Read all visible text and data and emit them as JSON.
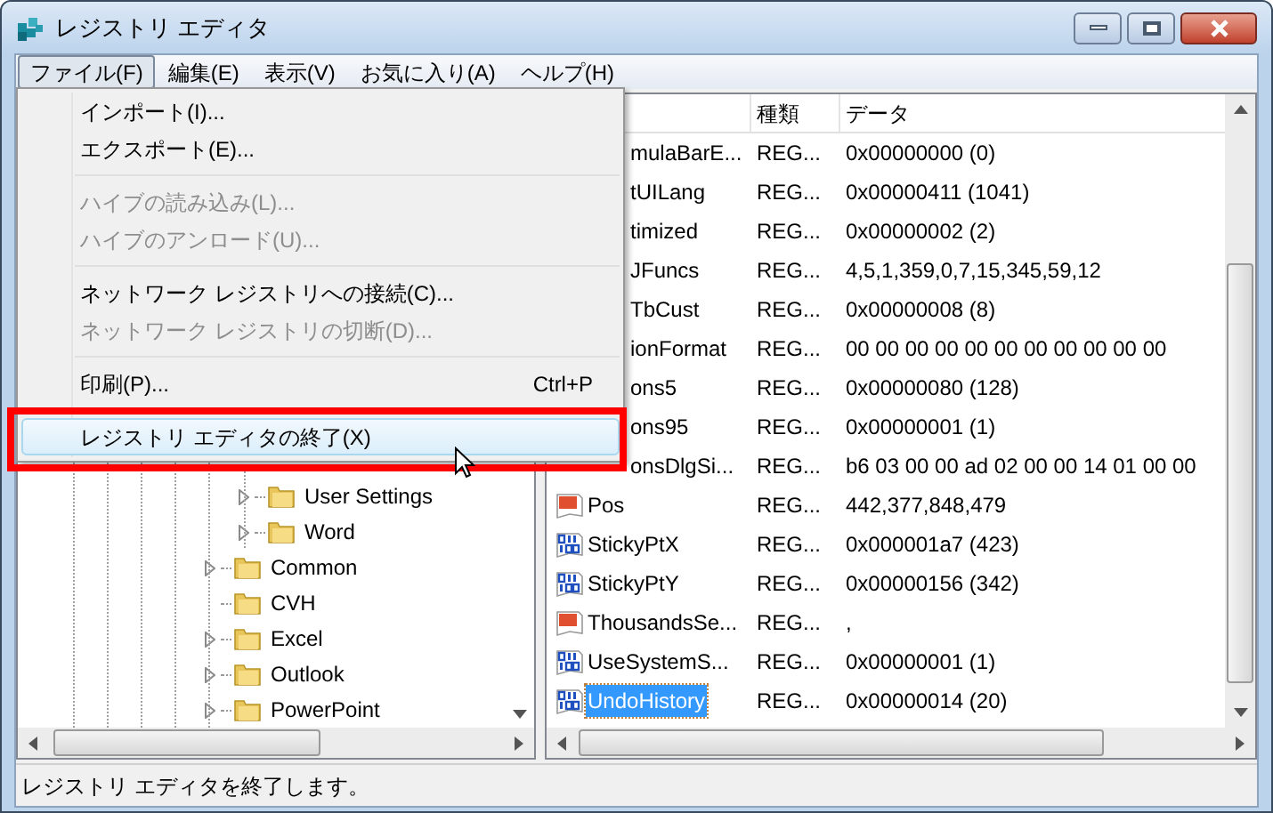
{
  "window": {
    "title": "レジストリ エディタ"
  },
  "menu_bar": [
    {
      "label": "ファイル(F)",
      "selected": true
    },
    {
      "label": "編集(E)",
      "selected": false
    },
    {
      "label": "表示(V)",
      "selected": false
    },
    {
      "label": "お気に入り(A)",
      "selected": false
    },
    {
      "label": "ヘルプ(H)",
      "selected": false
    }
  ],
  "file_menu": [
    {
      "kind": "item",
      "label": "インポート(I)...",
      "disabled": false,
      "highlighted": false,
      "annotated": false
    },
    {
      "kind": "item",
      "label": "エクスポート(E)...",
      "disabled": false,
      "highlighted": false,
      "annotated": false
    },
    {
      "kind": "separator"
    },
    {
      "kind": "item",
      "label": "ハイブの読み込み(L)...",
      "disabled": true,
      "highlighted": false,
      "annotated": false
    },
    {
      "kind": "item",
      "label": "ハイブのアンロード(U)...",
      "disabled": true,
      "highlighted": false,
      "annotated": false
    },
    {
      "kind": "separator"
    },
    {
      "kind": "item",
      "label": "ネットワーク レジストリへの接続(C)...",
      "disabled": false,
      "highlighted": false,
      "annotated": false
    },
    {
      "kind": "item",
      "label": "ネットワーク レジストリの切断(D)...",
      "disabled": true,
      "highlighted": false,
      "annotated": false
    },
    {
      "kind": "separator"
    },
    {
      "kind": "item",
      "label": "印刷(P)...",
      "shortcut": "Ctrl+P",
      "disabled": false,
      "highlighted": false,
      "annotated": false
    },
    {
      "kind": "separator"
    },
    {
      "kind": "item",
      "label": "レジストリ エディタの終了(X)",
      "disabled": false,
      "highlighted": true,
      "annotated": true
    }
  ],
  "tree": {
    "items": [
      {
        "children": [
          {
            "label": "User Settings",
            "expandable": true
          },
          {
            "label": "Word",
            "expandable": true
          }
        ]
      },
      {
        "label": "Common",
        "expandable": true
      },
      {
        "label": "CVH",
        "expandable": false
      },
      {
        "label": "Excel",
        "expandable": true
      },
      {
        "label": "Outlook",
        "expandable": true
      },
      {
        "label": "PowerPoint",
        "expandable": true
      }
    ]
  },
  "values": {
    "columns": [
      "種類",
      "データ"
    ],
    "rows": [
      {
        "name": "mulaBarE...",
        "type": "REG...",
        "data": "0x00000000 (0)",
        "selected": false
      },
      {
        "name": "tUILang",
        "type": "REG...",
        "data": "0x00000411 (1041)",
        "selected": false
      },
      {
        "name": "timized",
        "type": "REG...",
        "data": "0x00000002 (2)",
        "selected": false
      },
      {
        "name": "JFuncs",
        "type": "REG...",
        "data": "4,5,1,359,0,7,15,345,59,12",
        "selected": false
      },
      {
        "name": "TbCust",
        "type": "REG...",
        "data": "0x00000008 (8)",
        "selected": false
      },
      {
        "name": "ionFormat",
        "type": "REG...",
        "data": "00 00 00 00 00 00 00 00 00 00 00",
        "selected": false
      },
      {
        "name": "ons5",
        "type": "REG...",
        "data": "0x00000080 (128)",
        "selected": false
      },
      {
        "name": "ons95",
        "type": "REG...",
        "data": "0x00000001 (1)",
        "selected": false
      },
      {
        "name": "onsDlgSi...",
        "type": "REG...",
        "data": "b6 03 00 00 ad 02 00 00 14 01 00 00",
        "selected": false
      },
      {
        "kind": "string",
        "name": "Pos",
        "type": "REG...",
        "data": "442,377,848,479",
        "selected": false
      },
      {
        "kind": "number",
        "name": "StickyPtX",
        "type": "REG...",
        "data": "0x000001a7 (423)",
        "selected": false
      },
      {
        "kind": "number",
        "name": "StickyPtY",
        "type": "REG...",
        "data": "0x00000156 (342)",
        "selected": false
      },
      {
        "kind": "string",
        "name": "ThousandsSe...",
        "type": "REG...",
        "data": ",",
        "selected": false
      },
      {
        "kind": "number",
        "name": "UseSystemS...",
        "type": "REG...",
        "data": "0x00000001 (1)",
        "selected": false
      },
      {
        "kind": "number",
        "name": "UndoHistory",
        "type": "REG...",
        "data": "0x00000014 (20)",
        "selected": true
      }
    ]
  },
  "status_bar": "レジストリ エディタを終了します。"
}
